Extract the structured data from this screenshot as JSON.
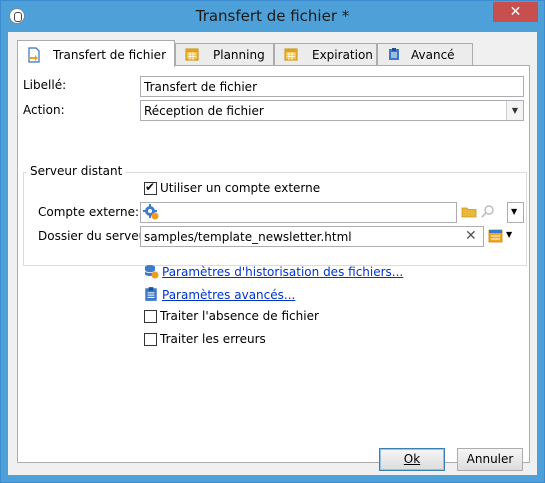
{
  "window": {
    "title": "Transfert de fichier *",
    "close_glyph": "✕"
  },
  "tabs": [
    {
      "label": "Transfert de fichier",
      "icon": "file-transfer-icon",
      "active": true
    },
    {
      "label": "Planning",
      "icon": "calendar-icon",
      "active": false
    },
    {
      "label": "Expiration",
      "icon": "calendar-icon",
      "active": false
    },
    {
      "label": "Avancé",
      "icon": "clipboard-icon",
      "active": false
    }
  ],
  "form": {
    "libelle_label": "Libellé:",
    "libelle_value": "Transfert de fichier",
    "action_label": "Action:",
    "action_value": "Réception de fichier"
  },
  "remote_server": {
    "group_title": "Serveur distant",
    "use_external_label": "Utiliser un compte externe",
    "use_external_checked": true,
    "external_account_label": "Compte externe:",
    "external_account_value": "",
    "server_folder_label": "Dossier du serveur:",
    "server_folder_value": "samples/template_newsletter.html"
  },
  "links": {
    "history_params": "Paramètres d'historisation des fichiers...",
    "advanced_params": "Paramètres avancés..."
  },
  "options": {
    "missing_file_label": "Traiter l'absence de fichier",
    "missing_file_checked": false,
    "errors_label": "Traiter les erreurs",
    "errors_checked": false
  },
  "buttons": {
    "ok": "Ok",
    "cancel": "Annuler"
  },
  "colors": {
    "titlebar": "#4da0d8",
    "close": "#c7504f",
    "link": "#0033cc"
  }
}
